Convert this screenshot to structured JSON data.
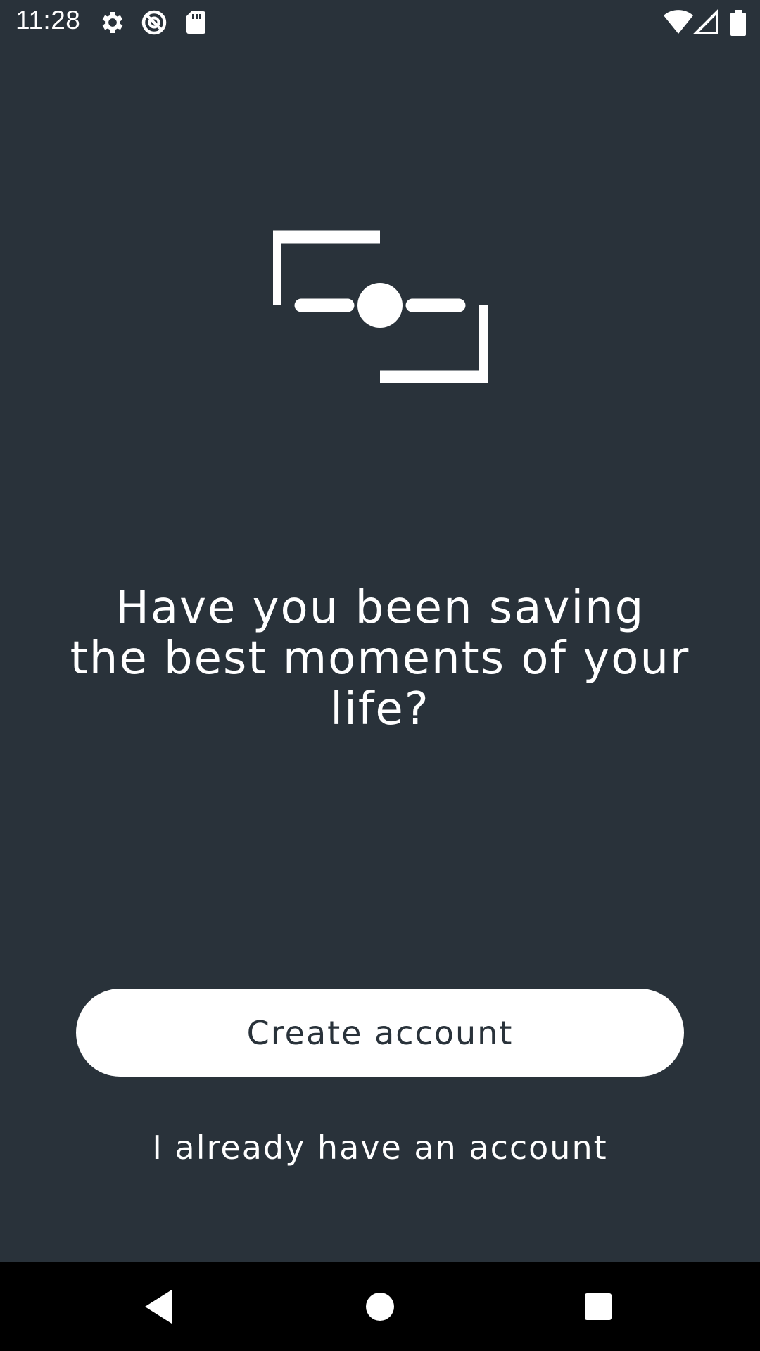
{
  "status_bar": {
    "time": "11:28",
    "left_icons": [
      "settings-icon",
      "do-not-disturb-icon",
      "sd-card-icon"
    ],
    "right_icons": [
      "wifi-icon",
      "cellular-signal-icon",
      "battery-icon"
    ]
  },
  "logo": {
    "icon": "camera-frame-logo-icon"
  },
  "headline": {
    "line1": "Have you been saving",
    "line2": "the best moments of your",
    "line3": "life?"
  },
  "actions": {
    "create_account_label": "Create account",
    "login_label": "I already have an account"
  },
  "nav_bar": {
    "icons": [
      "back-icon",
      "home-icon",
      "recents-icon"
    ]
  },
  "colors": {
    "background": "#29323a",
    "foreground": "#ffffff",
    "nav_background": "#000000"
  }
}
